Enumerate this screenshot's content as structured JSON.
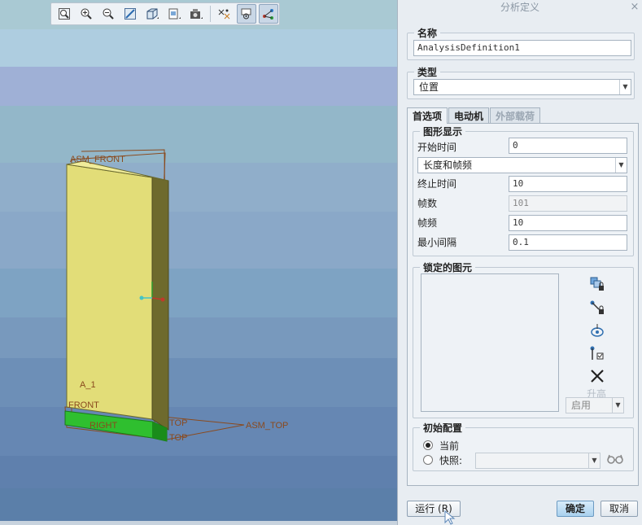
{
  "toolbar": {
    "buttons": [
      {
        "icon": "refit-icon"
      },
      {
        "icon": "zoom-in-icon"
      },
      {
        "icon": "zoom-out-icon"
      },
      {
        "icon": "repaint-icon"
      },
      {
        "icon": "view-orientation-icon"
      },
      {
        "icon": "saved-views-icon"
      },
      {
        "icon": "display-style-icon"
      },
      {
        "icon": "datum-display-icon"
      },
      {
        "icon": "spin-center-icon"
      },
      {
        "icon": "mechanism-display-icon"
      }
    ]
  },
  "model": {
    "labels": {
      "asm_front_top": "ASM_FRONT",
      "a1": "A_1",
      "front": "FRONT",
      "top1": "TOP",
      "top2": "TOP",
      "asm_top": "ASM_TOP",
      "right": "RIGHT"
    },
    "colors": {
      "body": "#e2dd78",
      "side": "#6e6a2d",
      "base": "#2fbf2f",
      "datum": "#8a4a1e"
    }
  },
  "dialog": {
    "title": "分析定义",
    "close": "×",
    "name_group": {
      "title": "名称",
      "value": "AnalysisDefinition1"
    },
    "type_group": {
      "title": "类型",
      "selected": "位置"
    },
    "tabs": [
      "首选项",
      "电动机",
      "外部载荷"
    ],
    "graph_display": {
      "title": "图形显示",
      "start_time_label": "开始时间",
      "start_time_value": "0",
      "mode_selected": "长度和帧频",
      "end_time_label": "终止时间",
      "end_time_value": "10",
      "frames_label": "帧数",
      "frames_value": "101",
      "frame_rate_label": "帧频",
      "frame_rate_value": "10",
      "min_interval_label": "最小间隔",
      "min_interval_value": "0.1"
    },
    "locked_entities": {
      "title": "锁定的图元",
      "icons": [
        "lock-body-icon",
        "lock-connection-icon",
        "lock-motor-icon",
        "lock-drag-icon",
        "delete-icon"
      ],
      "lift_label": "升高",
      "enable_selected": "启用"
    },
    "initial_config": {
      "title": "初始配置",
      "current_label": "当前",
      "snapshot_label": "快照:",
      "current_selected": true
    },
    "buttons": {
      "run": "运行 (R)",
      "ok": "确定",
      "cancel": "取消"
    }
  }
}
